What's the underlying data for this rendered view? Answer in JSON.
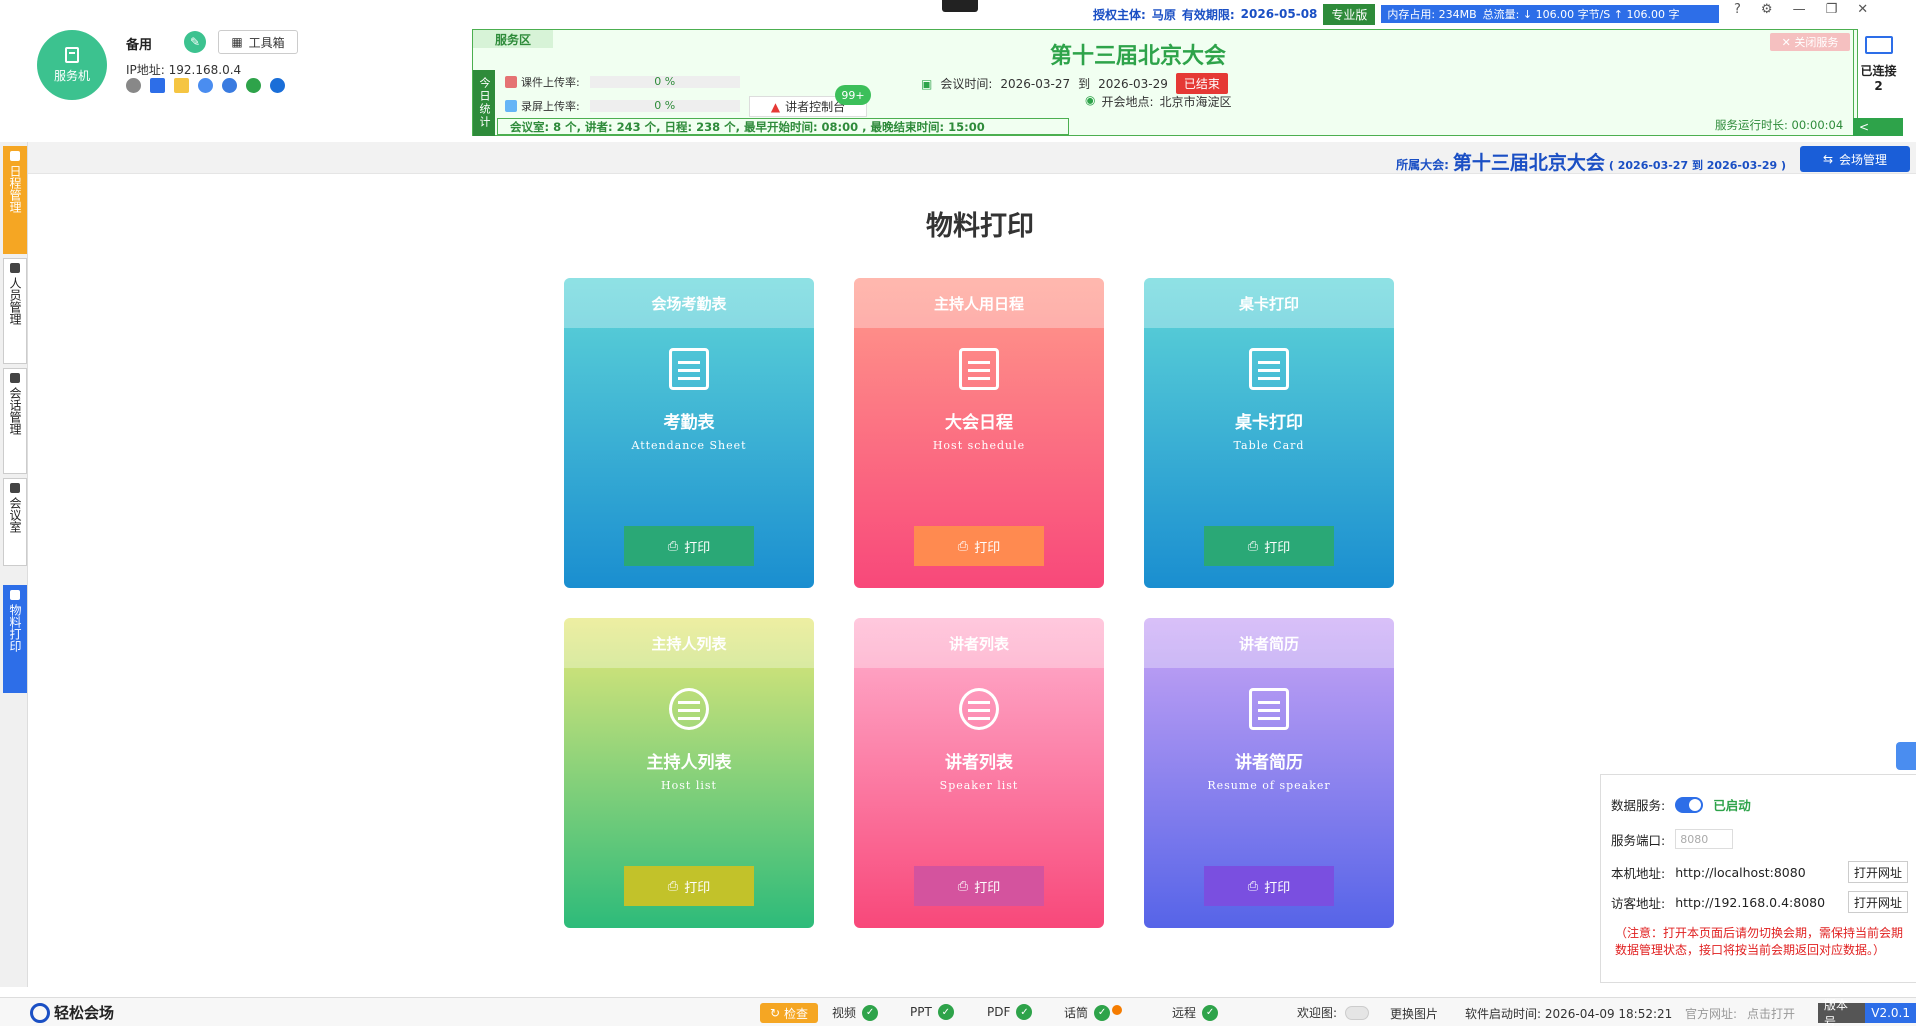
{
  "server": {
    "label": "服务机",
    "node_name": "备用",
    "toolbox": "工具箱",
    "ip": "IP地址: 192.168.0.4"
  },
  "top_status": {
    "auth_label": "授权主体:",
    "auth_name": "马原",
    "expiry_label": "有效期限:",
    "expiry_date": "2026-05-08",
    "edition": "专业版",
    "memory": "内存占用:  234MB",
    "traffic": "总流量:  ↓ 106.00 字节/S    ↑ 106.00 字"
  },
  "service_zone": {
    "label": "服务区",
    "today_stats": "今日统计",
    "courseware_upload": "课件上传率:",
    "courseware_pct": "0 %",
    "record_upload": "录屏上传率:",
    "record_pct": "0 %",
    "speaker_console": "讲者控制台",
    "badge": "99+",
    "stats_line": "会议室:   8 个,   讲者:   243 个,   日程:   238 个,   最早开始时间:   08:00 ,     最晚结束时间:   15:00",
    "conference_title": "第十三届北京大会",
    "time_label": "会议时间:",
    "start_date": "2026-03-27",
    "to": "到",
    "end_date": "2026-03-29",
    "ended": "已结束",
    "place_label": "开会地点:",
    "place": "北京市海淀区",
    "close_service": "✕ 关闭服务",
    "runtime": "服务运行时长: 00:00:04",
    "connected_label": "已连接",
    "connected_count": "2"
  },
  "nav": [
    {
      "label": "日程管理"
    },
    {
      "label": "人员管理"
    },
    {
      "label": "会话管理"
    },
    {
      "label": "会议室"
    },
    {
      "label": "物料打印"
    }
  ],
  "conf_bar": {
    "label": "所属大会:",
    "name": "第十三届北京大会",
    "dates": "( 2026-03-27 到 2026-03-29 )",
    "venue_btn": "会场管理"
  },
  "page_title": "物料打印",
  "cards": [
    {
      "header": "会场考勤表",
      "name": "考勤表",
      "en": "Attendance Sheet",
      "btn": "打印"
    },
    {
      "header": "主持人用日程",
      "name": "大会日程",
      "en": "Host schedule",
      "btn": "打印"
    },
    {
      "header": "桌卡打印",
      "name": "桌卡打印",
      "en": "Table Card",
      "btn": "打印"
    },
    {
      "header": "主持人列表",
      "name": "主持人列表",
      "en": "Host list",
      "btn": "打印"
    },
    {
      "header": "讲者列表",
      "name": "讲者列表",
      "en": "Speaker list",
      "btn": "打印"
    },
    {
      "header": "讲者简历",
      "name": "讲者简历",
      "en": "Resume of speaker",
      "btn": "打印"
    }
  ],
  "data_panel": {
    "service_label": "数据服务:",
    "service_status": "已启动",
    "port_label": "服务端口:",
    "port_placeholder": "8080",
    "local_label": "本机地址:",
    "local_url": "http://localhost:8080",
    "visitor_label": "访客地址:",
    "visitor_url": "http://192.168.0.4:8080",
    "open_btn": "打开网址",
    "note": "（注意：打开本页面后请勿切换会期，需保持当前会期数据管理状态，接口将按当前会期返回对应数据。）"
  },
  "bottom": {
    "brand": "轻松会场",
    "check": "检查",
    "items": [
      "视频",
      "PPT",
      "PDF",
      "话筒",
      "远程"
    ],
    "welcome": "欢迎图:",
    "change_img": "更换图片",
    "start_time": "软件启动时间:  2026-04-09 18:52:21",
    "official_label": "官方网址:",
    "official_link": "点击打开",
    "version_label": "版本号",
    "version": "V2.0.1"
  }
}
